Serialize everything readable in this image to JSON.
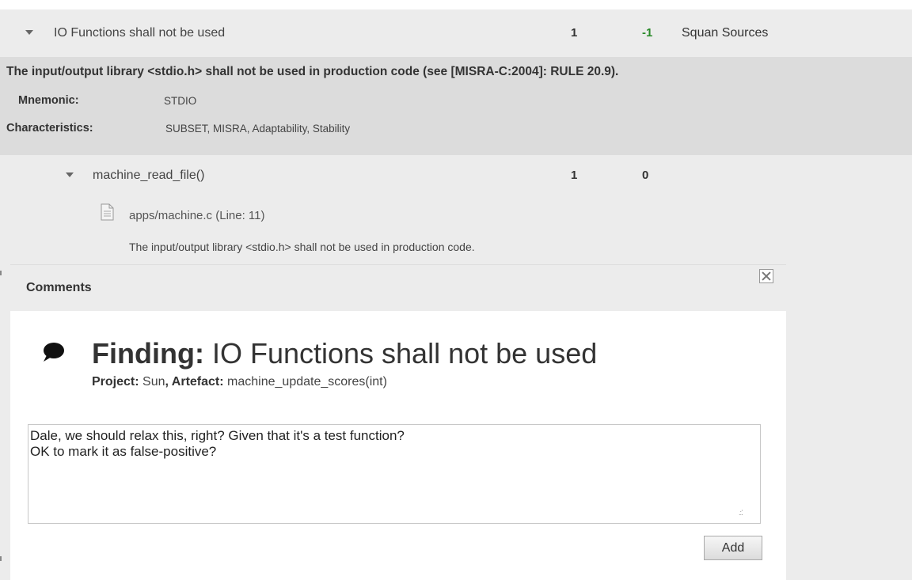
{
  "finding_row": {
    "label": "IO Functions shall not be used",
    "count": "1",
    "delta": "-1",
    "source": "Squan Sources"
  },
  "description": {
    "title": "The input/output library <stdio.h> shall not be used in production code (see [MISRA-C:2004]: RULE 20.9).",
    "mnemonic_key": "Mnemonic:",
    "mnemonic_value": "STDIO",
    "characteristics_key": "Characteristics:",
    "characteristics_value": "SUBSET, MISRA, Adaptability, Stability"
  },
  "child_row": {
    "label": "machine_read_file()",
    "count": "1",
    "delta": "0",
    "file": "apps/machine.c (Line: 11)",
    "message": "The input/output library <stdio.h> shall not be used in production code."
  },
  "dialog": {
    "title": "Comments",
    "finding_prefix": "Finding:",
    "finding_name": " IO Functions shall not be used",
    "project_key": "Project:",
    "project_value": " Sun",
    "artefact_key": ", Artefact:",
    "artefact_value": " machine_update_scores(int)",
    "comment_text": "Dale, we should relax this, right? Given that it's a test function?\nOK to mark it as false-positive?",
    "add_label": "Add"
  },
  "colors": {
    "row_bg": "#ececec",
    "desc_bg": "#dcdcdc",
    "positive_delta": "#2a8a2a"
  },
  "icons": [
    "expand-triangle-icon",
    "file-icon",
    "close-icon",
    "speech-bubble-icon"
  ]
}
